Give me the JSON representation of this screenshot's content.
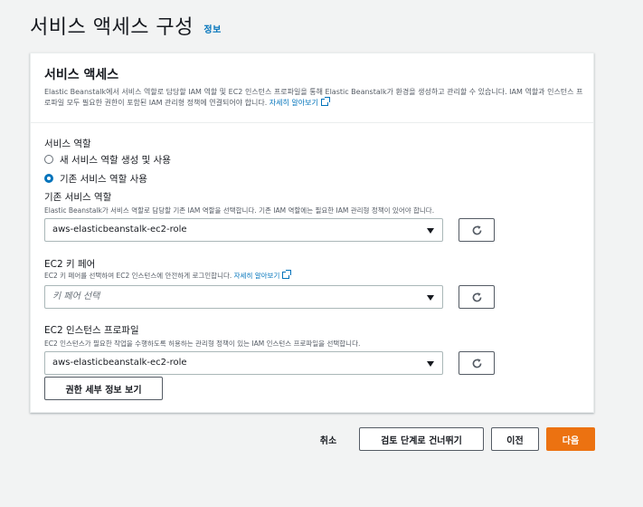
{
  "page": {
    "title": "서비스 액세스 구성",
    "info_link": "정보"
  },
  "panel": {
    "title": "서비스 액세스",
    "description": "Elastic Beanstalk에서 서비스 역할로 담당할 IAM 역할 및 EC2 인스턴스 프로파일을 통해 Elastic Beanstalk가 환경을 생성하고 관리할 수 있습니다. IAM 역할과 인스턴스 프로파일 모두 필요한 권한이 포함된 IAM 관리형 정책에 연결되어야 합니다.",
    "learn_more": "자세히 알아보기"
  },
  "service_role": {
    "label": "서비스 역할",
    "options": [
      {
        "label": "새 서비스 역할 생성 및 사용",
        "checked": false
      },
      {
        "label": "기존 서비스 역할 사용",
        "checked": true
      }
    ]
  },
  "existing_role": {
    "label": "기존 서비스 역할",
    "hint": "Elastic Beanstalk가 서비스 역할로 담당할 기존 IAM 역할을 선택합니다. 기존 IAM 역할에는 필요한 IAM 관리형 정책이 있어야 합니다.",
    "value": "aws-elasticbeanstalk-ec2-role"
  },
  "key_pair": {
    "label": "EC2 키 페어",
    "hint": "EC2 키 페어를 선택하여 EC2 인스턴스에 안전하게 로그인합니다.",
    "learn_more": "자세히 알아보기",
    "placeholder": "키 페어 선택"
  },
  "instance_profile": {
    "label": "EC2 인스턴스 프로파일",
    "hint": "EC2 인스턴스가 필요한 작업을 수행하도록 허용하는 관리형 정책이 있는 IAM 인스턴스 프로파일을 선택합니다.",
    "value": "aws-elasticbeanstalk-ec2-role",
    "view_permissions": "권한 세부 정보 보기"
  },
  "footer": {
    "cancel": "취소",
    "skip_to_review": "검토 단계로 건너뛰기",
    "previous": "이전",
    "next": "다음"
  },
  "icons": {
    "refresh": "refresh-icon",
    "external_link": "external-link-icon",
    "caret": "caret-down-icon"
  },
  "colors": {
    "primary": "#ec7211",
    "link": "#0073bb"
  }
}
